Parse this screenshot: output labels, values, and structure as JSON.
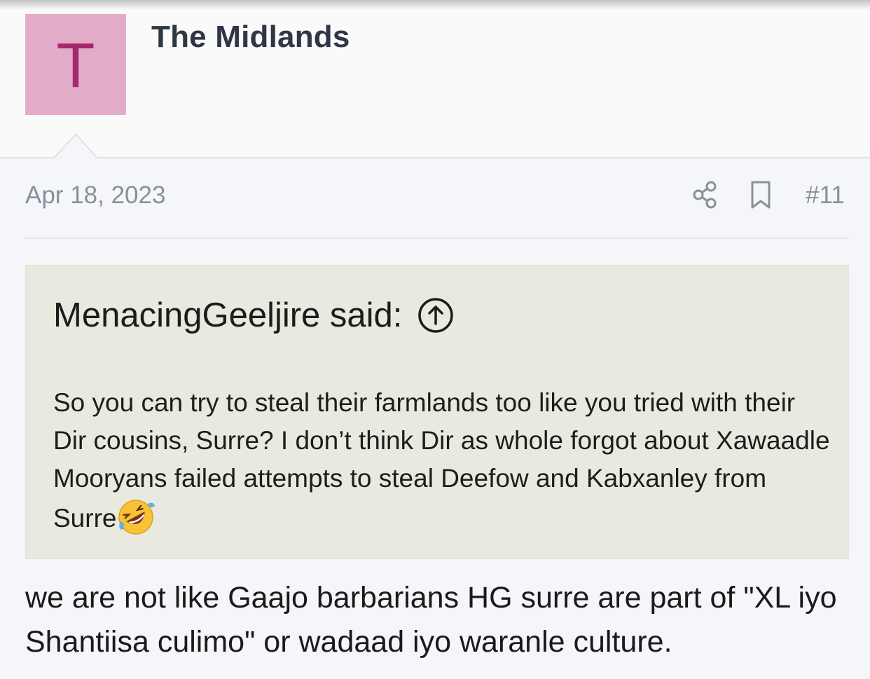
{
  "author": {
    "avatar_letter": "T",
    "avatar_color": "#e2acc9",
    "avatar_letter_color": "#a5286e",
    "username": "The Midlands"
  },
  "post": {
    "date": "Apr 18, 2023",
    "number": "#11",
    "share_icon": "share-icon",
    "bookmark_icon": "bookmark-icon"
  },
  "quote": {
    "attribution": "MenacingGeeljire said:",
    "jump_icon": "arrow-up-circle-icon",
    "text": "So you can try to steal their farmlands too like you tried with their Dir cousins, Surre? I don’t think Dir as whole forgot about Xawaadle Mooryans failed attempts to steal Deefow and Kabxanley from Surre",
    "emoji": "rolling-on-the-floor-laughing-emoji",
    "background_color": "#eae9df"
  },
  "body": {
    "text": "we are not like Gaajo barbarians HG surre are part of \"XL iyo Shantiisa culimo\" or wadaad iyo waranle culture."
  }
}
